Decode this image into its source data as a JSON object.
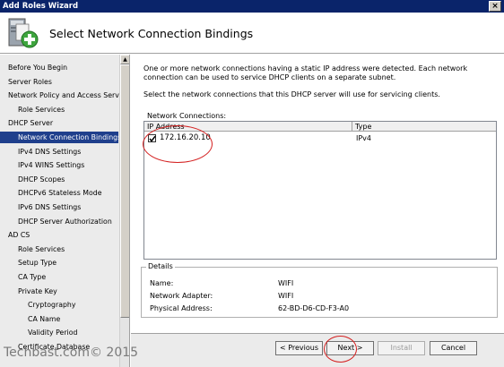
{
  "window": {
    "title": "Add Roles Wizard",
    "close_glyph": "×"
  },
  "header": {
    "title": "Select Network Connection Bindings"
  },
  "sidebar": {
    "items": [
      {
        "label": "Before You Begin",
        "indent": 0,
        "active": false
      },
      {
        "label": "Server Roles",
        "indent": 0,
        "active": false
      },
      {
        "label": "Network Policy and Access Services",
        "indent": 0,
        "active": false
      },
      {
        "label": "Role Services",
        "indent": 1,
        "active": false
      },
      {
        "label": "DHCP Server",
        "indent": 0,
        "active": false
      },
      {
        "label": "Network Connection Bindings",
        "indent": 1,
        "active": true
      },
      {
        "label": "IPv4 DNS Settings",
        "indent": 1,
        "active": false
      },
      {
        "label": "IPv4 WINS Settings",
        "indent": 1,
        "active": false
      },
      {
        "label": "DHCP Scopes",
        "indent": 1,
        "active": false
      },
      {
        "label": "DHCPv6 Stateless Mode",
        "indent": 1,
        "active": false
      },
      {
        "label": "IPv6 DNS Settings",
        "indent": 1,
        "active": false
      },
      {
        "label": "DHCP Server Authorization",
        "indent": 1,
        "active": false
      },
      {
        "label": "AD CS",
        "indent": 0,
        "active": false
      },
      {
        "label": "Role Services",
        "indent": 1,
        "active": false
      },
      {
        "label": "Setup Type",
        "indent": 1,
        "active": false
      },
      {
        "label": "CA Type",
        "indent": 1,
        "active": false
      },
      {
        "label": "Private Key",
        "indent": 1,
        "active": false
      },
      {
        "label": "Cryptography",
        "indent": 2,
        "active": false
      },
      {
        "label": "CA Name",
        "indent": 2,
        "active": false
      },
      {
        "label": "Validity Period",
        "indent": 2,
        "active": false
      },
      {
        "label": "Certificate Database",
        "indent": 1,
        "active": false
      }
    ]
  },
  "main": {
    "intro": "One or more network connections having a static IP address were detected. Each network connection can be used to service DHCP clients on a separate subnet.",
    "instruction": "Select the network connections that this DHCP server will use for servicing clients.",
    "connections_label": "Network Connections:",
    "table": {
      "columns": [
        "IP Address",
        "Type"
      ],
      "rows": [
        {
          "checked": true,
          "ip": "172.16.20.10",
          "type": "IPv4"
        }
      ]
    },
    "details": {
      "label": "Details",
      "fields": [
        {
          "name": "Name:",
          "value": "WIFI"
        },
        {
          "name": "Network Adapter:",
          "value": "WIFI"
        },
        {
          "name": "Physical Address:",
          "value": "62-BD-D6-CD-F3-A0"
        }
      ]
    }
  },
  "footer": {
    "previous": "< Previous",
    "next": "Next >",
    "install": "Install",
    "cancel": "Cancel"
  },
  "watermark": "Techbast.com© 2015",
  "colors": {
    "titlebar": "#0a246a",
    "active_item": "#1f3f8c",
    "annotation": "#d42020"
  }
}
